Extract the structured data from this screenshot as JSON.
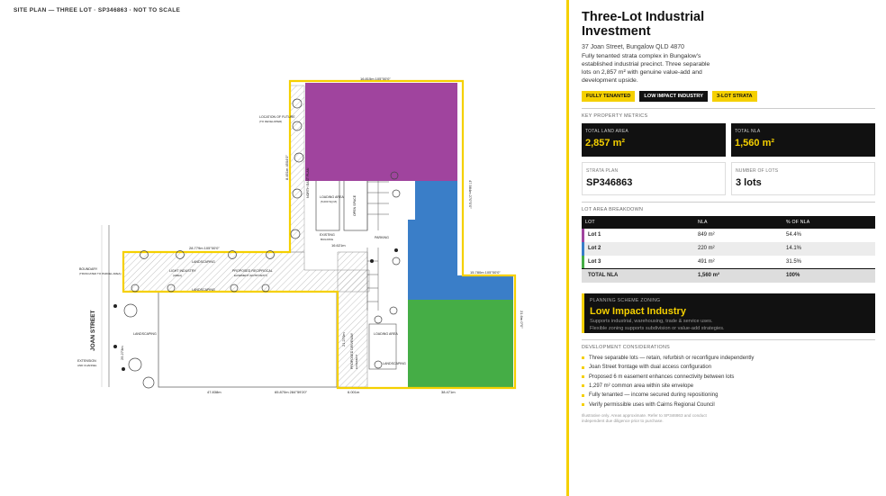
{
  "plan": {
    "header": "SITE PLAN — THREE LOT · SP346863 · NOT TO SCALE",
    "street": "JOAN STREET",
    "dims": {
      "top": "16.815m 105°00'0\"",
      "left_north": "28.779m 105°00'0\"",
      "east_upper": "47.984m 270°0'0\"",
      "right_step": "15.780m 105°00'0\"",
      "east_lower": "21.6m 0°0\"",
      "bottom_mid": "65.870m 284°59'20\"",
      "bottom_left": "47.838m",
      "bottom_right": "38.471m",
      "bottom_small": "6.001m",
      "vertical_mid": "21.270m",
      "vertical_west": "25.273m",
      "vertical_left_up": "8.451m 4504'0\"",
      "inner": "16.621m"
    },
    "labels": {
      "landscaping_1": "LANDSCAPING",
      "landscaping_2": "LANDSCAPING",
      "landscaping_3": "LANDSCAPING",
      "landscaping_4": "LANDSCAPING",
      "easement": "LIGHT INDUSTRY",
      "easement_sub": "(AREA)",
      "proposed": "PROPOSED RECIPROCAL",
      "proposed_sub": "EASEMENT (ENTRY/EXIT)",
      "loading": "LOADING AREA",
      "loading_sub": "(5,000 SQ M)",
      "parking": "PARKING",
      "existing": "EXISTING",
      "existing_sub": "BUILDING",
      "loading_2": "LOADING AREA",
      "driveway": "PROPOSED DRIVEWAY",
      "driveway_sub": "EASEMENT",
      "open_space": "OPEN SPACE",
      "north_label": "NORTH EAST PLAN",
      "west_note": "BOUNDARY",
      "west_note_sub": "(TRUNCATED TO PARCEL AREA)",
      "ext_1": "EXTENSION",
      "ext_1_sub": "AND CHANNEL",
      "top_note": "LOCATION OF FUTURE",
      "top_note_sub": "(TO DEVELOPER)"
    }
  },
  "panel": {
    "title": "Three-Lot Industrial Investment",
    "address": "37 Joan Street, Bungalow QLD 4870",
    "description": "Fully tenanted strata complex in Bungalow's established industrial precinct. Three separable lots on 2,857 m² with genuine value-add and development upside.",
    "tags": [
      "FULLY TENANTED",
      "LOW IMPACT INDUSTRY",
      "3-LOT STRATA"
    ],
    "metrics_label": "KEY PROPERTY METRICS",
    "metrics": [
      {
        "label": "TOTAL LAND AREA",
        "value": "2,857 m²"
      },
      {
        "label": "TOTAL NLA",
        "value": "1,560 m²"
      },
      {
        "label": "STRATA PLAN",
        "value": "SP346863"
      },
      {
        "label": "NUMBER OF LOTS",
        "value": "3 lots"
      }
    ],
    "lots_label": "LOT AREA BREAKDOWN",
    "lot_table": {
      "headers": [
        "LOT",
        "NLA",
        "% OF NLA"
      ],
      "rows": [
        {
          "lot": "Lot 1",
          "nla": "849 m²",
          "pct": "54.4%",
          "color": "#a0449e"
        },
        {
          "lot": "Lot 2",
          "nla": "220 m²",
          "pct": "14.1%",
          "color": "#3a7ec8"
        },
        {
          "lot": "Lot 3",
          "nla": "491 m²",
          "pct": "31.5%",
          "color": "#45ad46"
        }
      ],
      "total": {
        "lot": "TOTAL NLA",
        "nla": "1,560 m²",
        "pct": "100%"
      }
    },
    "zoning": {
      "label": "PLANNING SCHEME ZONING",
      "title": "Low Impact Industry",
      "line1": "Supports industrial, warehousing, trade & service uses.",
      "line2": "Flexible zoning supports subdivision or value-add strategies."
    },
    "considerations_label": "DEVELOPMENT CONSIDERATIONS",
    "considerations": [
      "Three separable lots — retain, refurbish or reconfigure independently",
      "Joan Street frontage with dual access configuration",
      "Proposed 6 m easement enhances connectivity between lots",
      "1,297 m² common area within site envelope",
      "Fully tenanted — income secured during repositioning",
      "Verify permissible uses with Cairns Regional Council"
    ],
    "disclaimer": "Illustrative only. Areas approximate. Refer to SP346863 and conduct independent due diligence prior to purchase.",
    "colors": {
      "accent": "#f5d000",
      "lot1": "#a0449e",
      "lot2": "#3a7ec8",
      "lot3": "#45ad46"
    }
  }
}
